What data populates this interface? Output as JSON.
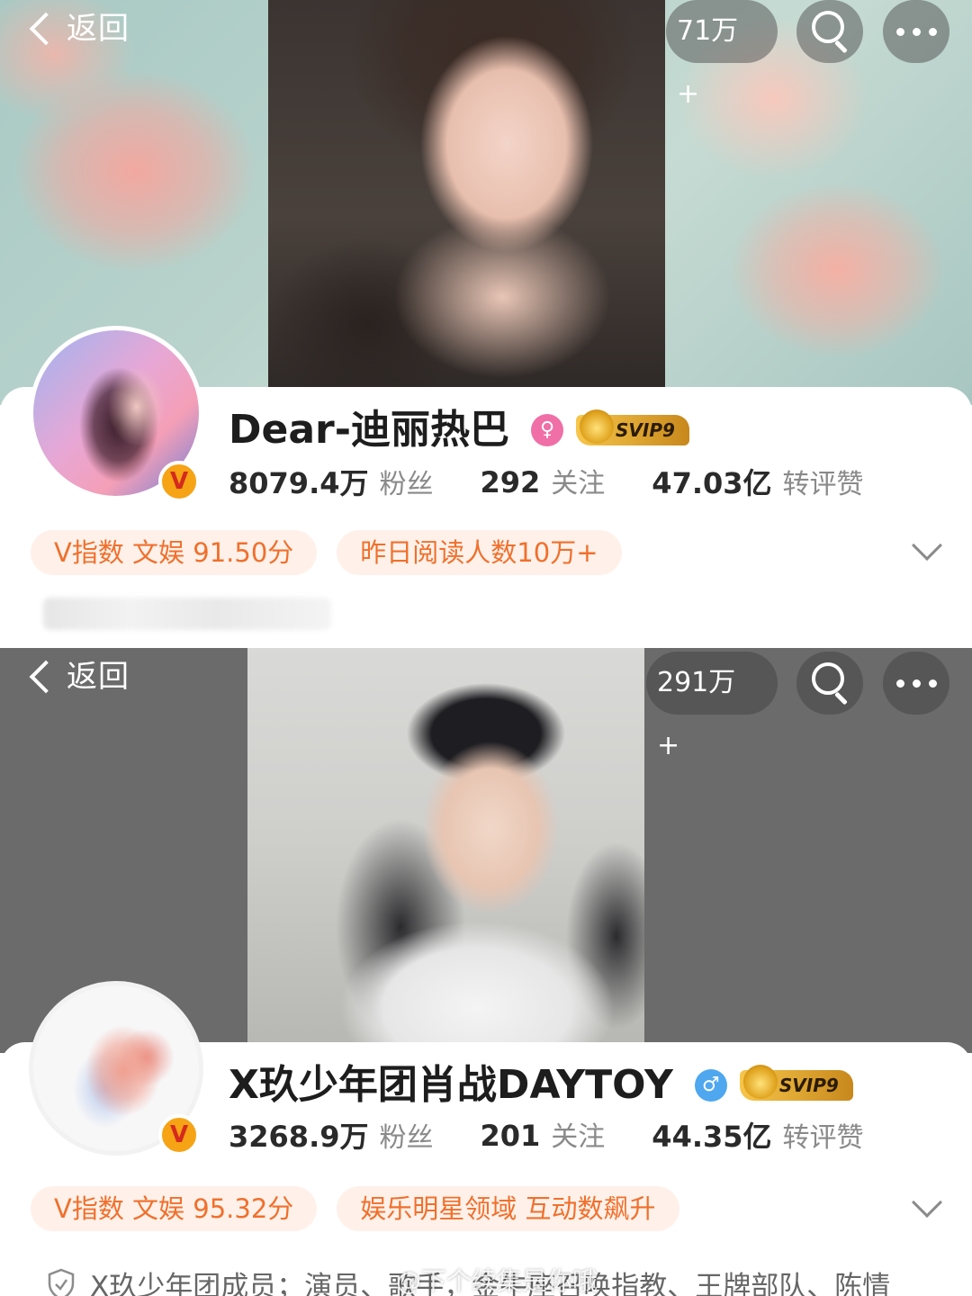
{
  "profiles": [
    {
      "back_label": "返回",
      "count_badge": "71万+",
      "name": "Dear-迪丽热巴",
      "gender_symbol": "♀",
      "svip_label": "SVIP9",
      "verify_badge": "V",
      "stats": [
        {
          "value": "8079.4万",
          "label": "粉丝"
        },
        {
          "value": "292",
          "label": "关注"
        },
        {
          "value": "47.03亿",
          "label": "转评赞"
        }
      ],
      "tags": [
        "V指数 文娱 91.50分",
        "昨日阅读人数10万+"
      ]
    },
    {
      "back_label": "返回",
      "count_badge": "291万+",
      "name": "X玖少年团肖战DAYTOY",
      "gender_symbol": "♂",
      "svip_label": "SVIP9",
      "verify_badge": "V",
      "stats": [
        {
          "value": "3268.9万",
          "label": "粉丝"
        },
        {
          "value": "201",
          "label": "关注"
        },
        {
          "value": "44.35亿",
          "label": "转评赞"
        }
      ],
      "tags": [
        "V指数 文娱 95.32分",
        "娱乐明星领域 互动数飙升"
      ],
      "bio": "X玖少年团成员；演员、歌手，金牛座召唤指教、王牌部队、陈情"
    }
  ],
  "watermark": "@下个续集是你哦",
  "colors": {
    "tag_text": "#f0702c",
    "tag_bg": "#fff1ea",
    "gender_female": "#ef6fa6",
    "gender_male": "#4ea7ef",
    "verify_badge": "#f6a315"
  }
}
